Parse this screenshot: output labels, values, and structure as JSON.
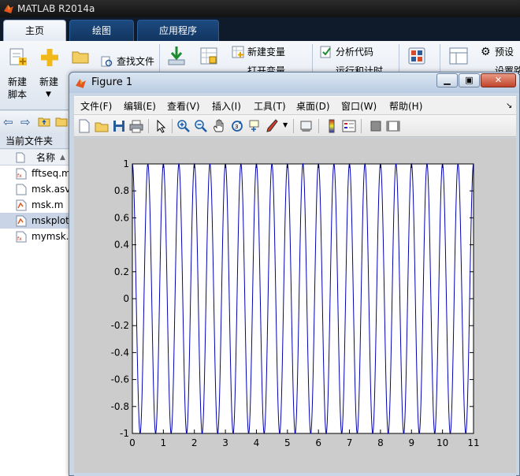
{
  "app": {
    "title": "MATLAB R2014a",
    "tabs": [
      {
        "label": "主页",
        "active": true
      },
      {
        "label": "绘图",
        "active": false
      },
      {
        "label": "应用程序",
        "active": false
      }
    ]
  },
  "ribbon": {
    "new_script_label_line1": "新建",
    "new_script_label_line2": "脚本",
    "new_label": "新建",
    "find_files_label": "查找文件",
    "new_variable_label": "新建变量",
    "open_variable_label": "打开变量",
    "analyze_code_label": "分析代码",
    "run_and_time_label": "运行和计时",
    "preferences_label": "预设",
    "set_path_label": "设置路"
  },
  "file_browser": {
    "current_folder_label": "当前文件夹",
    "name_column": "名称",
    "files": [
      {
        "name": "fftseq.m",
        "type": "m",
        "selected": false
      },
      {
        "name": "msk.asv",
        "type": "asv",
        "selected": false
      },
      {
        "name": "msk.m",
        "type": "m",
        "selected": false
      },
      {
        "name": "mskplot.m",
        "type": "m",
        "selected": true
      },
      {
        "name": "mymsk.m",
        "type": "m",
        "selected": false
      }
    ]
  },
  "figure": {
    "title": "Figure 1",
    "menus": [
      "文件(F)",
      "编辑(E)",
      "查看(V)",
      "插入(I)",
      "工具(T)",
      "桌面(D)",
      "窗口(W)",
      "帮助(H)"
    ],
    "toolbar_icons": [
      "new-figure-icon",
      "open-file-icon",
      "save-icon",
      "print-icon",
      "edit-plot-arrow-icon",
      "zoom-in-icon",
      "zoom-out-icon",
      "pan-hand-icon",
      "rotate-3d-icon",
      "data-cursor-icon",
      "brush-icon",
      "link-plot-icon",
      "colorbar-icon",
      "legend-icon",
      "hide-plot-tools-icon",
      "show-plot-tools-icon"
    ]
  },
  "colors": {
    "line": "#0000b0",
    "titlebar": "#1a1a1a",
    "ribbon_tab_active": "#f2f5f9"
  },
  "chart_data": {
    "type": "line",
    "title": "",
    "xlabel": "",
    "ylabel": "",
    "xlim": [
      0,
      11
    ],
    "ylim": [
      -1,
      1
    ],
    "xticks": [
      0,
      1,
      2,
      3,
      4,
      5,
      6,
      7,
      8,
      9,
      10,
      11
    ],
    "yticks": [
      -1,
      -0.8,
      -0.6,
      -0.4,
      -0.2,
      0,
      0.2,
      0.4,
      0.6,
      0.8,
      1
    ],
    "ytick_labels": [
      "-1",
      "-0.8",
      "-0.6",
      "-0.4",
      "-0.2",
      "0",
      "0.2",
      "0.4",
      "0.6",
      "0.8",
      "1"
    ],
    "grid": false,
    "series": [
      {
        "function": "cos",
        "cycles_in_range": 22,
        "x_start": 0,
        "x_end": 11,
        "amplitude": 1
      }
    ]
  }
}
